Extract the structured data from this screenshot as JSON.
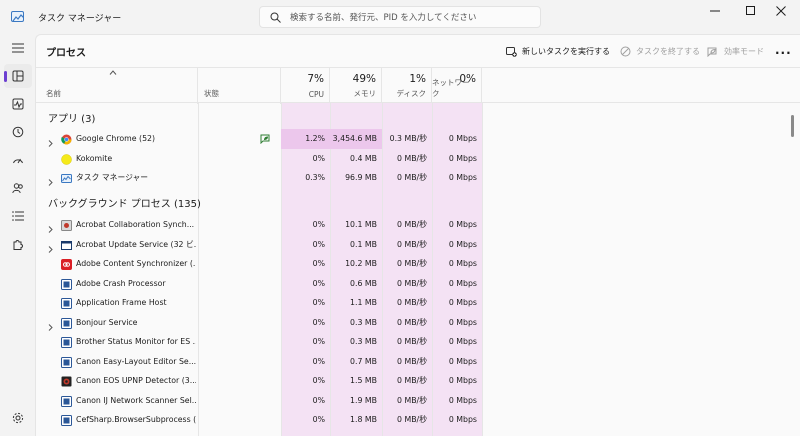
{
  "window": {
    "title": "タスク マネージャー"
  },
  "search": {
    "placeholder": "検索する名前、発行元、PID を入力してください"
  },
  "page": {
    "title": "プロセス"
  },
  "toolbar": {
    "run_new_task": "新しいタスクを実行する",
    "end_task": "タスクを終了する",
    "efficiency_mode": "効率モード"
  },
  "columns": {
    "name": "名前",
    "status": "状態",
    "cpu": {
      "percent": "7%",
      "label": "CPU"
    },
    "memory": {
      "percent": "49%",
      "label": "メモリ"
    },
    "disk": {
      "percent": "1%",
      "label": "ディスク"
    },
    "network": {
      "percent": "0%",
      "label": "ネットワーク"
    }
  },
  "sections": {
    "apps": "アプリ (3)",
    "background": "バックグラウンド プロセス (135)"
  },
  "apps": [
    {
      "name": "Google Chrome (52)",
      "icon": "chrome-icon",
      "expandable": true,
      "eco": true,
      "cpu": "1.2%",
      "mem": "3,454.6 MB",
      "disk": "0.3 MB/秒",
      "net": "0 Mbps"
    },
    {
      "name": "Kokomite",
      "icon": "kokomite-icon",
      "expandable": false,
      "eco": false,
      "cpu": "0%",
      "mem": "0.4 MB",
      "disk": "0 MB/秒",
      "net": "0 Mbps"
    },
    {
      "name": "タスク マネージャー",
      "icon": "task-manager-icon",
      "expandable": true,
      "eco": false,
      "cpu": "0.3%",
      "mem": "96.9 MB",
      "disk": "0 MB/秒",
      "net": "0 Mbps"
    }
  ],
  "background": [
    {
      "name": "Acrobat Collaboration Synch...",
      "icon": "acrobat-sync-icon",
      "expandable": true,
      "cpu": "0%",
      "mem": "10.1 MB",
      "disk": "0 MB/秒",
      "net": "0 Mbps"
    },
    {
      "name": "Acrobat Update Service (32 ビ...",
      "icon": "window-icon",
      "expandable": true,
      "cpu": "0%",
      "mem": "0.1 MB",
      "disk": "0 MB/秒",
      "net": "0 Mbps"
    },
    {
      "name": "Adobe Content Synchronizer (...",
      "icon": "adobe-cc-icon",
      "expandable": false,
      "cpu": "0%",
      "mem": "10.2 MB",
      "disk": "0 MB/秒",
      "net": "0 Mbps"
    },
    {
      "name": "Adobe Crash Processor",
      "icon": "process-icon",
      "expandable": false,
      "cpu": "0%",
      "mem": "0.6 MB",
      "disk": "0 MB/秒",
      "net": "0 Mbps"
    },
    {
      "name": "Application Frame Host",
      "icon": "process-icon",
      "expandable": false,
      "cpu": "0%",
      "mem": "1.1 MB",
      "disk": "0 MB/秒",
      "net": "0 Mbps"
    },
    {
      "name": "Bonjour Service",
      "icon": "process-icon",
      "expandable": true,
      "cpu": "0%",
      "mem": "0.3 MB",
      "disk": "0 MB/秒",
      "net": "0 Mbps"
    },
    {
      "name": "Brother Status Monitor for ES ...",
      "icon": "process-icon",
      "expandable": false,
      "cpu": "0%",
      "mem": "0.3 MB",
      "disk": "0 MB/秒",
      "net": "0 Mbps"
    },
    {
      "name": "Canon Easy-Layout Editor Se...",
      "icon": "process-icon",
      "expandable": false,
      "cpu": "0%",
      "mem": "0.7 MB",
      "disk": "0 MB/秒",
      "net": "0 Mbps"
    },
    {
      "name": "Canon EOS UPNP Detector (3...",
      "icon": "canon-icon",
      "expandable": false,
      "cpu": "0%",
      "mem": "1.5 MB",
      "disk": "0 MB/秒",
      "net": "0 Mbps"
    },
    {
      "name": "Canon IJ Network Scanner Sel...",
      "icon": "process-icon",
      "expandable": false,
      "cpu": "0%",
      "mem": "1.9 MB",
      "disk": "0 MB/秒",
      "net": "0 Mbps"
    },
    {
      "name": "CefSharp.BrowserSubprocess (...",
      "icon": "process-icon",
      "expandable": false,
      "cpu": "0%",
      "mem": "1.8 MB",
      "disk": "0 MB/秒",
      "net": "0 Mbps"
    }
  ],
  "colors": {
    "heat_light": "#f4e2f4",
    "heat_medium": "#ecc7ec",
    "accent": "#6c3fd1"
  }
}
